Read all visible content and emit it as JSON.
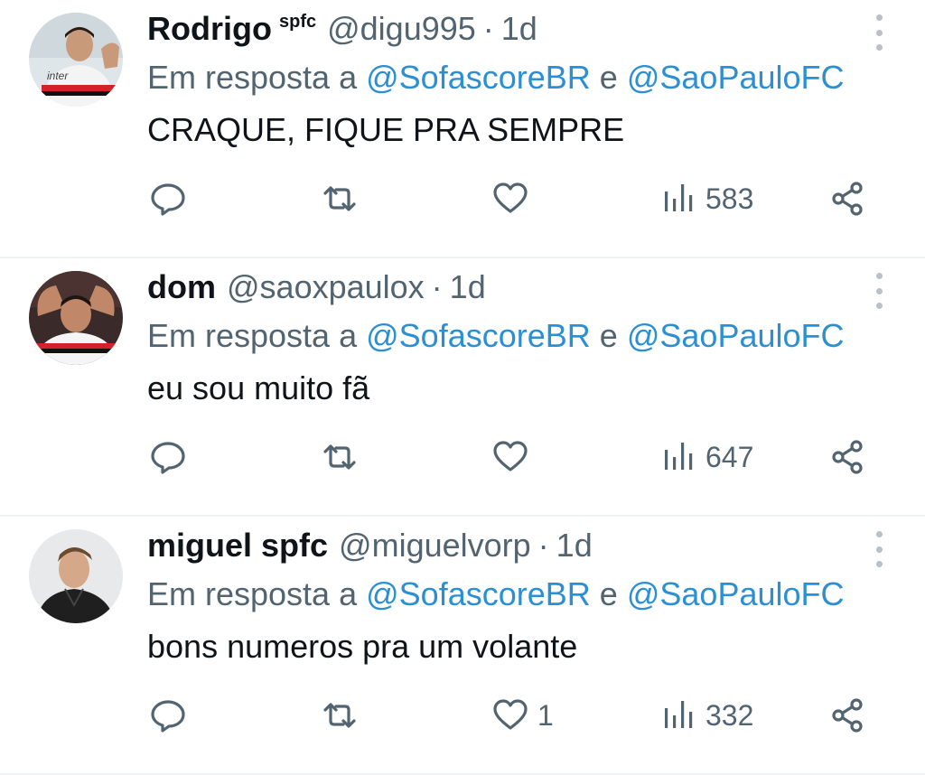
{
  "tweets": [
    {
      "name": "Rodrigo",
      "name_sup": "spfc",
      "handle": "@digu995",
      "separator": "·",
      "time": "1d",
      "reply_prefix": "Em resposta a",
      "mention1": "@SofascoreBR",
      "conj": "e",
      "mention2": "@SaoPauloFC",
      "text": "CRAQUE, FIQUE PRA SEMPRE",
      "likes": "",
      "views": "583"
    },
    {
      "name": "dom",
      "handle": "@saoxpaulox",
      "separator": "·",
      "time": "1d",
      "reply_prefix": "Em resposta a",
      "mention1": "@SofascoreBR",
      "conj": "e",
      "mention2": "@SaoPauloFC",
      "text": "eu sou muito fã",
      "likes": "",
      "views": "647"
    },
    {
      "name": "miguel spfc",
      "handle": "@miguelvorp",
      "separator": "·",
      "time": "1d",
      "reply_prefix": "Em resposta a",
      "mention1": "@SofascoreBR",
      "conj": "e",
      "mention2": "@SaoPauloFC",
      "text": "bons numeros pra um volante",
      "likes": "1",
      "views": "332"
    }
  ],
  "icons": {
    "reply": "reply-icon",
    "retweet": "retweet-icon",
    "like": "heart-icon",
    "views": "views-icon",
    "share": "share-icon",
    "more": "more-icon"
  },
  "colors": {
    "text": "#0f1419",
    "muted": "#536471",
    "mention": "#2b8fd4",
    "divider": "#eff3f4"
  }
}
